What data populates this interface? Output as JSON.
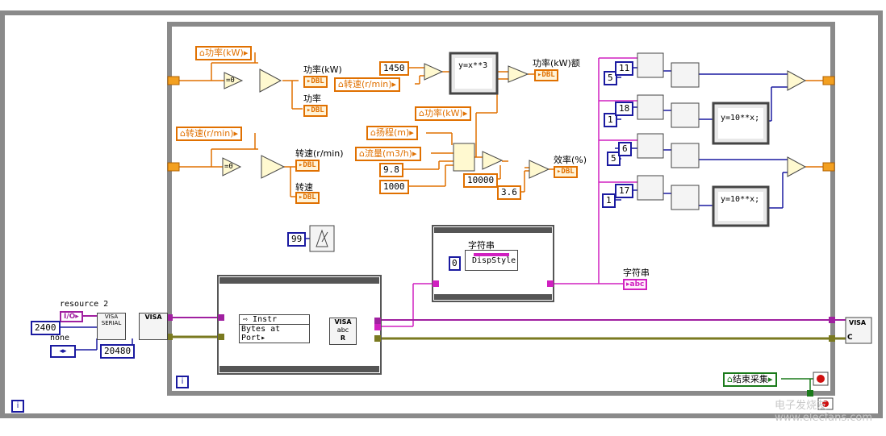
{
  "watermark": "电子发烧友 www.elecfans.com",
  "outer_loop": {
    "info_icon": "i"
  },
  "inner_loop": {
    "info_icon": "i"
  },
  "power_block": {
    "control_label": "功率(kW)",
    "indicator_top_label": "功率(kW)",
    "indicator_bottom_label": "功率",
    "indicator_type": "DBL",
    "compare_zero": "=0"
  },
  "speed_block": {
    "control_label": "转速(r/min)",
    "indicator_top_label": "转速(r/min)",
    "indicator_bottom_label": "转速",
    "indicator_type": "DBL",
    "compare_zero": "=0"
  },
  "rated_power": {
    "const_1450": "1450",
    "speed_ctrl_label": "转速(r/min)",
    "formula": "y=x**3",
    "out_label": "功率(kW)额",
    "indicator_type": "DBL"
  },
  "efficiency": {
    "power_ctrl_label": "功率(kW)",
    "head_ctrl_label": "扬程(m)",
    "flow_ctrl_label": "流量(m3/h)",
    "const_9_8": "9.8",
    "const_1000": "1000",
    "const_10000": "10000",
    "const_3_6": "3.6",
    "out_label": "效率(%)",
    "indicator_type": "DBL"
  },
  "right_column": {
    "consts": [
      "5",
      "11",
      "1",
      "18",
      "5",
      "6",
      "1",
      "17"
    ],
    "formula": "y=10**x;",
    "x_label": "x",
    "y_label": "y"
  },
  "timer": {
    "const_99": "99"
  },
  "string_frame": {
    "label": "字符串",
    "zero": "0",
    "property": "DispStyle"
  },
  "string_indicator": {
    "label": "字符串",
    "type": "abc"
  },
  "visa": {
    "resource_label": "resource 2",
    "resource_type": "I/O",
    "baud": "2400",
    "none_label": "none",
    "buffer": "20480",
    "serial_text": "VISA SERIAL",
    "visa_text": "VISA",
    "property_instr": "Instr",
    "property_bytes": "Bytes at Port",
    "read_text": "abc",
    "read_r": "R",
    "close_text": "VISA",
    "close_c": "C"
  },
  "stop": {
    "label": "结束采集"
  },
  "colors": {
    "orange_wire": "#e07000",
    "blue_wire": "#1a1aa0",
    "pink_wire": "#d020c0",
    "olive_wire": "#7a7a20",
    "loop_gray": "#8a8a8a"
  }
}
